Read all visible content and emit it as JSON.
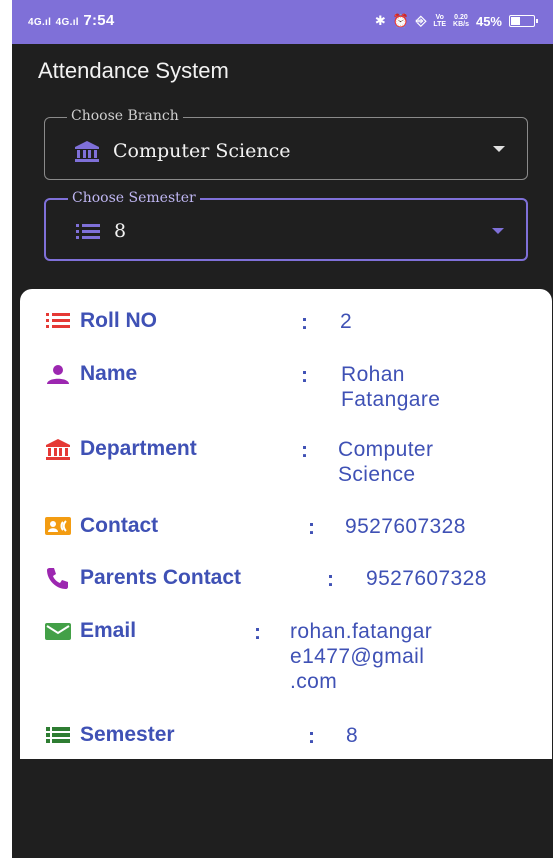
{
  "status_bar": {
    "network_1": "4G",
    "network_2": "4G",
    "time": "7:54",
    "net_speed": "0.20",
    "net_speed_unit": "KB/s",
    "battery": "45%",
    "battery_level": 0.45
  },
  "app": {
    "title": "Attendance System"
  },
  "branch": {
    "label": "Choose Branch",
    "value": "Computer Science",
    "icon": "institution-icon"
  },
  "semester_select": {
    "label": "Choose Semester",
    "value": "8",
    "icon": "list-icon"
  },
  "details": {
    "roll": {
      "label": "Roll NO",
      "colon": ":",
      "value": "2"
    },
    "name": {
      "label": "Name",
      "colon": ":",
      "value_line1": "Rohan",
      "value_line2": "Fatangare"
    },
    "department": {
      "label": "Department",
      "colon": ":",
      "value_line1": "Computer",
      "value_line2": "Science"
    },
    "contact": {
      "label": "Contact",
      "colon": ":",
      "value": "9527607328"
    },
    "parents_contact": {
      "label": "Parents Contact",
      "colon": ":",
      "value": "9527607328"
    },
    "email": {
      "label": "Email",
      "colon": ":",
      "value_line1": "rohan.fatangar",
      "value_line2": "e1477@gmail",
      "value_line3": ".com"
    },
    "semester": {
      "label": "Semester",
      "colon": ":",
      "value": "8"
    }
  },
  "colors": {
    "accent": "#7f70d8",
    "text_blue": "#3f51b5",
    "icon_red": "#e53935",
    "icon_purple": "#9c27b0",
    "icon_orange": "#f39c12",
    "icon_green": "#43a047",
    "background": "#1f1f1f"
  }
}
